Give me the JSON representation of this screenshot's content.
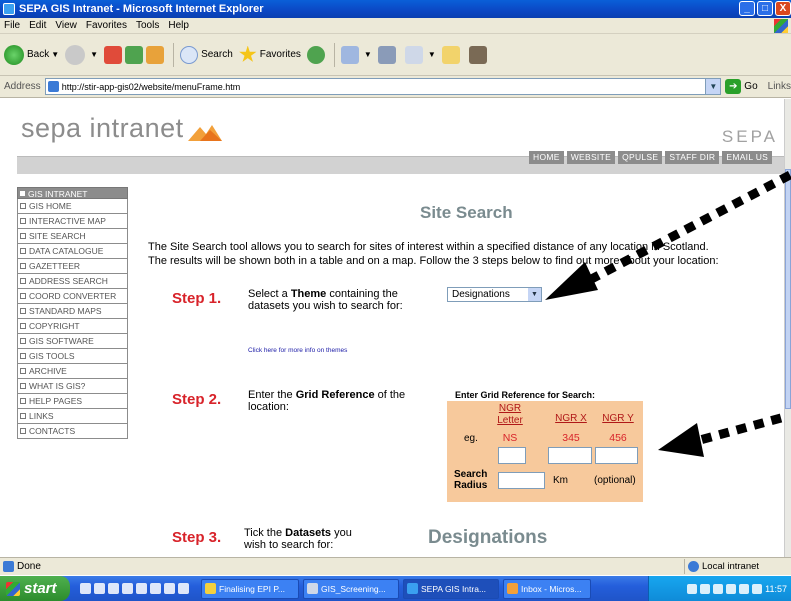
{
  "window": {
    "title": "SEPA GIS Intranet - Microsoft Internet Explorer",
    "buttons": {
      "minimize": "_",
      "maximize": "□",
      "close": "X"
    }
  },
  "menu": [
    "File",
    "Edit",
    "View",
    "Favorites",
    "Tools",
    "Help"
  ],
  "toolbar": {
    "back": "Back",
    "search": "Search",
    "favorites": "Favorites"
  },
  "address": {
    "label": "Address",
    "url": "http://stir-app-gis02/website/menuFrame.htm",
    "go": "Go",
    "links": "Links"
  },
  "site": {
    "brand": "sepa intranet",
    "logo": "SEPA",
    "nav": [
      "HOME",
      "WEBSITE",
      "QPULSE",
      "STAFF DIR",
      "EMAIL US"
    ]
  },
  "sidebar": {
    "header": "GIS INTRANET",
    "items": [
      "GIS HOME",
      "INTERACTIVE MAP",
      "SITE SEARCH",
      "DATA CATALOGUE",
      "GAZETTEER",
      "ADDRESS SEARCH",
      "COORD CONVERTER",
      "STANDARD MAPS",
      "COPYRIGHT",
      "GIS SOFTWARE",
      "GIS TOOLS",
      "ARCHIVE",
      "WHAT IS GIS?",
      "HELP PAGES",
      "LINKS",
      "CONTACTS"
    ]
  },
  "main": {
    "title": "Site Search",
    "intro_line1": "The Site Search tool allows you to search for sites of interest within a specified distance of any location in Scotland.",
    "intro_line2": "The results will be shown both in a table and on a map. Follow the 3 steps below to find out more about your location:",
    "step1": {
      "label": "Step 1.",
      "text_pre": "Select a ",
      "text_bold": "Theme",
      "text_post": " containing the datasets you wish to search for:",
      "select_value": "Designations",
      "more_link": "Click here for more info on themes"
    },
    "step2": {
      "label": "Step 2.",
      "text_pre": "Enter the ",
      "text_bold": "Grid Reference",
      "text_post": " of the location:",
      "grid_header": "Enter Grid Reference for Search:",
      "col_letter": "NGR Letter",
      "col_x": "NGR X",
      "col_y": "NGR Y",
      "eg_label": "eg.",
      "eg_letter": "NS",
      "eg_x": "345",
      "eg_y": "456",
      "radius_label": "Search Radius",
      "radius_unit": "Km",
      "radius_note": "(optional)"
    },
    "step3": {
      "label": "Step 3.",
      "text_pre": "Tick the ",
      "text_bold": "Datasets",
      "text_post": " you wish to search for:",
      "heading": "Designations"
    }
  },
  "status": {
    "left": "Done",
    "zone": "Local intranet"
  },
  "taskbar": {
    "start": "start",
    "tasks": [
      "Finalising EPI P...",
      "GIS_Screening...",
      "SEPA GIS Intra...",
      "Inbox - Micros..."
    ],
    "clock": "11:57"
  },
  "colors": {
    "step_red": "#d8232a",
    "title_gray": "#7a8b8f",
    "grid_box": "#f7c99c",
    "nav_gray": "#8c8c8c"
  }
}
